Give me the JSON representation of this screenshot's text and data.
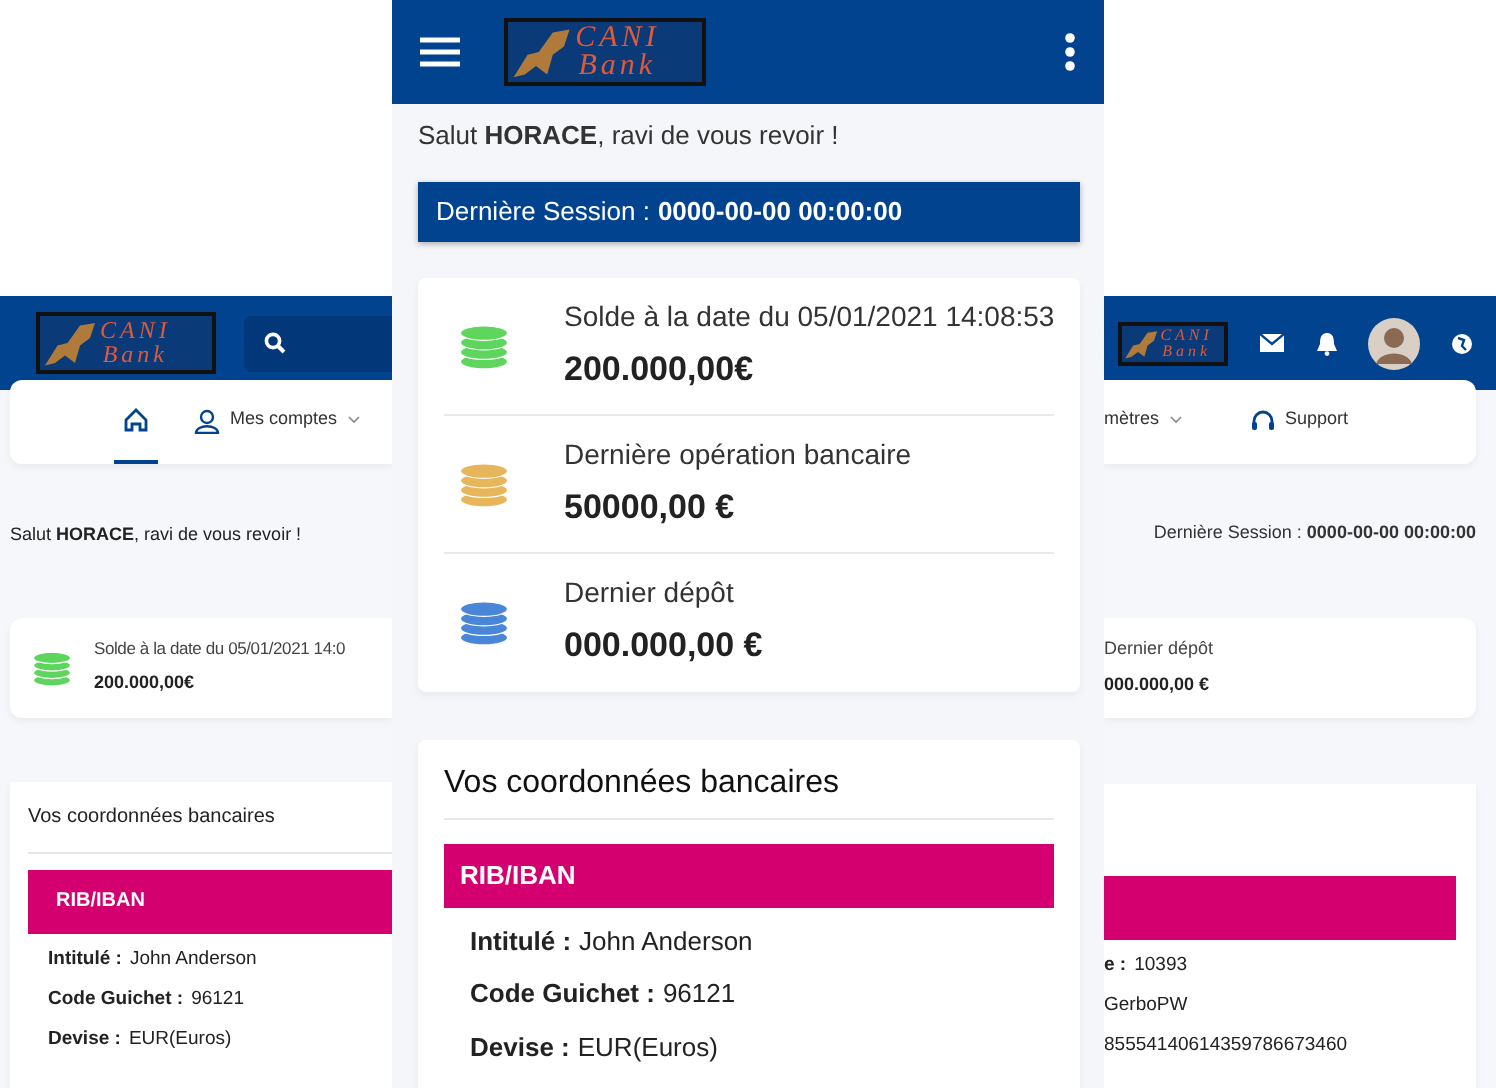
{
  "desktop_left": {
    "logo": {
      "top": "CANI",
      "bottom": "Bank"
    },
    "nav": [
      {
        "kind": "home",
        "selected": true
      },
      {
        "kind": "account",
        "label": "Mes comptes",
        "dropdown": true,
        "selected": false
      }
    ],
    "greeting": "Salut **HORACE**, ravi de vous revoir !",
    "balance": {
      "label": "Solde à la date du 05/01/2021 14:0",
      "amount": "200.000,00€",
      "color": "#5ed65e"
    },
    "bank_details": {
      "title": "Vos coordonnées bancaires",
      "header": "RIB/IBAN",
      "fields": [
        {
          "label": "Intitulé :",
          "value": "John Anderson"
        },
        {
          "label": "Code Guichet :",
          "value": "96121"
        },
        {
          "label": "Devise :",
          "value": "EUR(Euros)"
        }
      ]
    }
  },
  "phone": {
    "logo": {
      "top": "CANI",
      "bottom": "Bank"
    },
    "greeting": "Salut **HORACE**, ravi de vous revoir !",
    "session": {
      "label": "Dernière Session :",
      "value": "0000-00-00 00:00:00"
    },
    "balances": [
      {
        "label": "Solde à la date du 05/01/2021 14:08:53",
        "amount": "200.000,00€",
        "color": "#5ed65e"
      },
      {
        "label": "Dernière opération bancaire",
        "amount": "50000,00 €",
        "color": "#e8b65a"
      },
      {
        "label": "Dernier dépôt",
        "amount": "000.000,00 €",
        "color": "#4a86d8"
      }
    ],
    "bank_details": {
      "title": "Vos coordonnées bancaires",
      "header": "RIB/IBAN",
      "fields": [
        {
          "label": "Intitulé :",
          "value": "John Anderson"
        },
        {
          "label": "Code Guichet :",
          "value": "96121"
        },
        {
          "label": "Devise :",
          "value": "EUR(Euros)"
        }
      ]
    }
  },
  "desktop_right": {
    "logo": {
      "top": "CANI",
      "bottom": "Bank"
    },
    "nav": [
      {
        "kind": "plain",
        "label": "mètres",
        "dropdown": true,
        "selected": false
      },
      {
        "kind": "support",
        "label": "Support",
        "selected": false
      }
    ],
    "session": {
      "label": "Dernière Session :",
      "value": "0000-00-00 00:00:00"
    },
    "balance": {
      "label": "Dernier dépôt",
      "amount": "000.000,00 €"
    },
    "bank_details": {
      "fields": [
        {
          "label": "e :",
          "value": "10393"
        },
        {
          "value": "GerboPW"
        },
        {
          "value": "85554140614359786673460"
        }
      ]
    }
  }
}
